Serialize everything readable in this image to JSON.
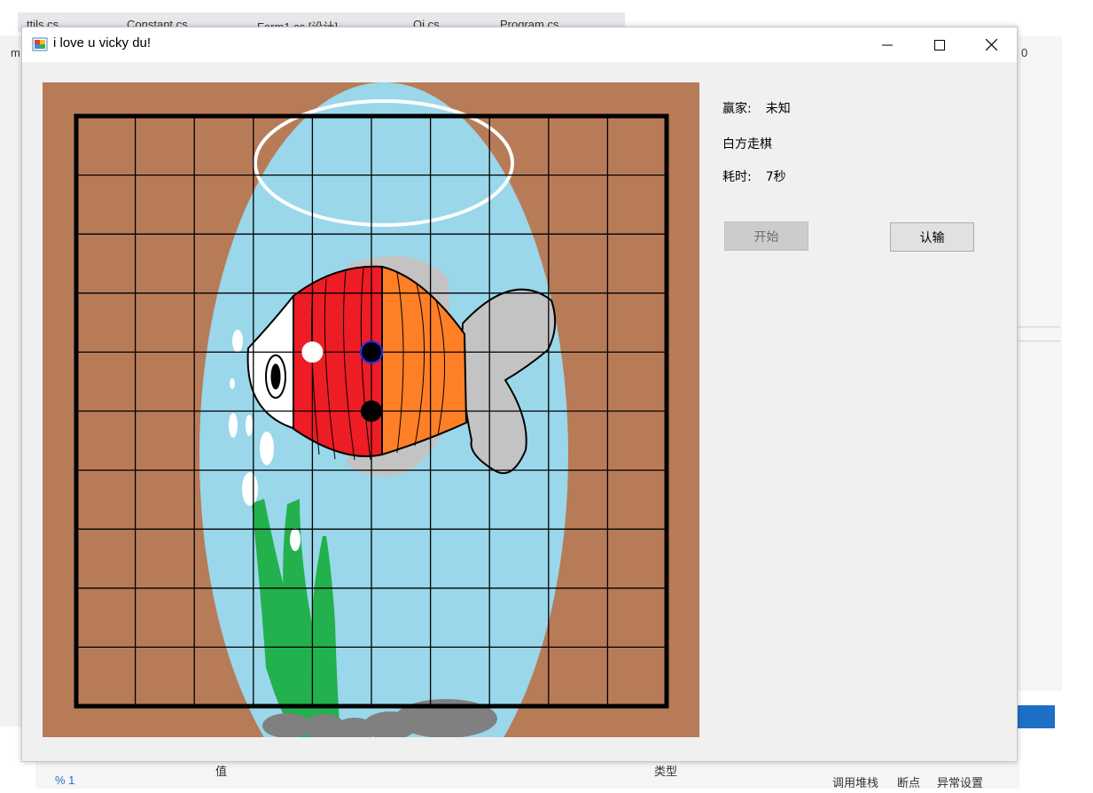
{
  "background": {
    "tabs": [
      "ttils.cs",
      "Constant.cs",
      "Form1.cs [设计]",
      "Qi.cs",
      "Program.cs"
    ],
    "right_fragment": "0",
    "left_fragment": "m",
    "bottom_texts": [
      "值",
      "类型",
      "调用堆栈",
      "断点",
      "异常设置"
    ],
    "bottom_left_num": "% 1"
  },
  "window": {
    "title": "i love u vicky du!",
    "controls": {
      "minimize": "minimize",
      "maximize": "maximize",
      "close": "close"
    }
  },
  "status": {
    "winner_label": "赢家:",
    "winner_value": "未知",
    "turn_text": "白方走棋",
    "time_label": "耗时:",
    "time_value": "7秒"
  },
  "buttons": {
    "start": "开始",
    "resign": "认输"
  },
  "board": {
    "grid_lines": 11,
    "colors": {
      "wood": "#b87b58",
      "water": "#9ad7ea",
      "grid": "#000000",
      "fish_red": "#ee1c24",
      "fish_orange": "#ff7f27",
      "fish_fin": "#c3c3c3",
      "seaweed": "#22b14c",
      "rocks": "#808080"
    },
    "stones": [
      {
        "color": "white",
        "col": 4,
        "row": 4
      },
      {
        "color": "black",
        "col": 5,
        "row": 4,
        "last_move": true
      },
      {
        "color": "black",
        "col": 5,
        "row": 5
      }
    ]
  }
}
